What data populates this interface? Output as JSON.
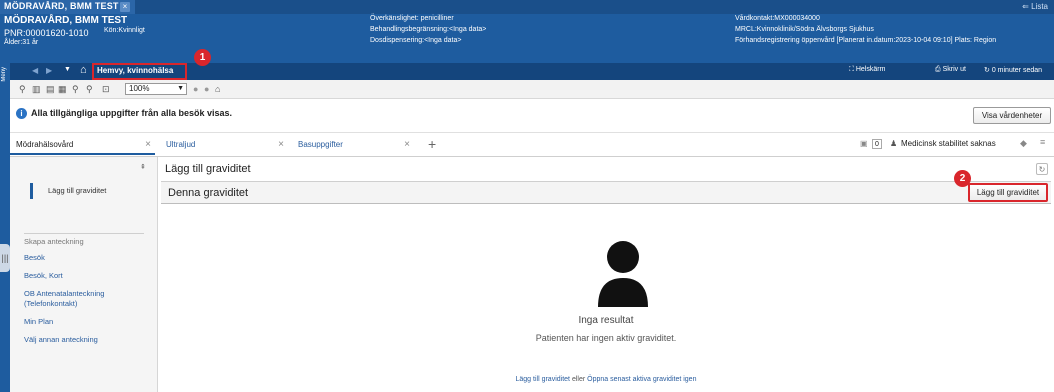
{
  "app_tab": {
    "title": "MÖDRAVÅRD, BMM TEST",
    "close": "×"
  },
  "lista": "⇐ Lista",
  "patient": {
    "name": "MÖDRAVÅRD, BMM TEST",
    "pnr": "PNR:00001620-1010",
    "sex": "Kön:Kvinnligt",
    "age": "Ålder:31 år"
  },
  "alerts": {
    "hypersensitivity": "Överkänslighet: penicilliner",
    "treatment_restriction": "Behandlingsbegränsning:<Inga data>",
    "dose_dispensing": "Dosdispensering:<Inga data>"
  },
  "contact": {
    "id": "Vårdkontakt:MX000034000",
    "unit": "MRCL:Kvinnoklinik/Södra Älvsborgs Sjukhus",
    "registration": "Förhandsregistrering öppenvård [Planerat in.datum:2023-10-04 09:10] Plats: Region"
  },
  "nav": {
    "menu_label": "Meny",
    "home_label": "Hemvy, kvinnohälsa",
    "right_items": [
      "Helskärm",
      "Skriv ut",
      "0 minuter sedan"
    ]
  },
  "annotations": {
    "badge1": "1",
    "badge2": "2"
  },
  "toolbar": {
    "zoom": "100%"
  },
  "info": {
    "message": "Alla tillgängliga uppgifter från alla besök visas.",
    "button": "Visa vårdenheter"
  },
  "tabs": {
    "items": [
      {
        "label": "Mödrahälsovård",
        "close": "×"
      },
      {
        "label": "Ultraljud",
        "close": "×"
      },
      {
        "label": "Basuppgifter",
        "close": "×"
      }
    ],
    "add": "+",
    "count": "0",
    "status": "Medicinsk stabilitet saknas"
  },
  "left_panel": {
    "primary": "Lägg till graviditet",
    "section_header": "Skapa anteckning",
    "items": [
      "Besök",
      "Besök, Kort",
      "OB Antenatalanteckning",
      "(Telefonkontakt)",
      "Min Plan",
      "Välj annan anteckning"
    ]
  },
  "main": {
    "title": "Lägg till graviditet",
    "section_title": "Denna graviditet",
    "add_button": "Lägg till graviditet",
    "empty_title": "Inga resultat",
    "empty_message": "Patienten har ingen aktiv graviditet.",
    "link1": "Lägg till graviditet",
    "link_sep": "eller",
    "link2": "Öppna senast aktiva graviditet igen"
  },
  "colors": {
    "header_blue": "#1e5c9f",
    "highlight_red": "#d9262c"
  }
}
